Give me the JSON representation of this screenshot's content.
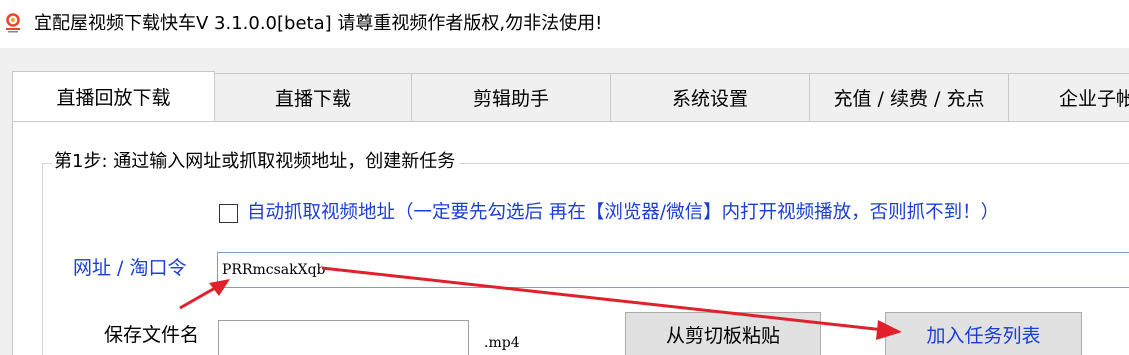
{
  "window": {
    "title": "宜配屋视频下载快车V 3.1.0.0[beta] 请尊重视频作者版权,勿非法使用!",
    "icon": "app-logo-icon"
  },
  "tabs": [
    {
      "label": "直播回放下载",
      "active": true
    },
    {
      "label": "直播下载",
      "active": false
    },
    {
      "label": "剪辑助手",
      "active": false
    },
    {
      "label": "系统设置",
      "active": false
    },
    {
      "label": "充值 / 续费 / 充点",
      "active": false
    },
    {
      "label": "企业子帐",
      "active": false
    }
  ],
  "step1": {
    "legend": "第1步: 通过输入网址或抓取视频地址，创建新任务",
    "auto_capture": {
      "checked": false,
      "label": "自动抓取视频地址（一定要先勾选后 再在【浏览器/微信】内打开视频播放，否则抓不到！）"
    },
    "url": {
      "label": "网址 / 淘口令",
      "value": "PRRmcsakXqb"
    },
    "filename": {
      "label": "保存文件名",
      "value": "",
      "extension": ".mp4"
    },
    "paste_button": "从剪切板粘贴",
    "add_button": "加入任务列表"
  },
  "colors": {
    "accent_text": "#1a3fd6",
    "annotation_arrow": "#e0202a"
  }
}
